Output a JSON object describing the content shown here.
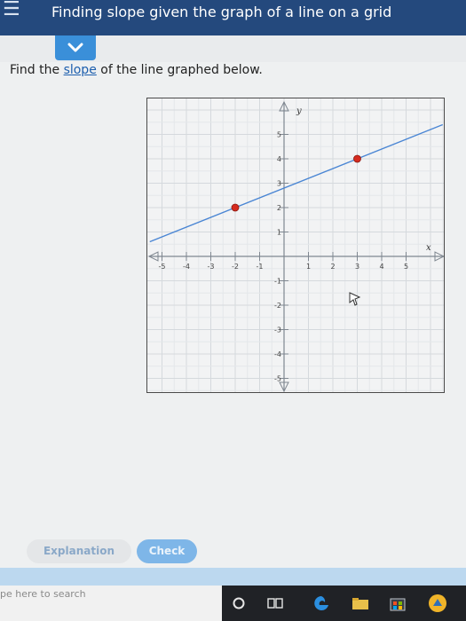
{
  "header": {
    "title": "Finding slope given the graph of a line on a grid"
  },
  "question": {
    "prefix": "Find the ",
    "link": "slope",
    "suffix": " of the line graphed below."
  },
  "graph": {
    "x_label": "x",
    "y_label": "y",
    "x_ticks": [
      "-5",
      "-4",
      "-3",
      "-2",
      "-1",
      "1",
      "2",
      "3",
      "4",
      "5"
    ],
    "y_ticks": [
      "5",
      "4",
      "3",
      "2",
      "1",
      "-1",
      "-2",
      "-3",
      "-4",
      "-5"
    ],
    "points": [
      {
        "x": -2,
        "y": 2
      },
      {
        "x": 3,
        "y": 4
      }
    ],
    "line_color": "#4a86d4",
    "point_color": "#d62b1f"
  },
  "buttons": {
    "explanation": "Explanation",
    "check": "Check"
  },
  "taskbar": {
    "search_placeholder": "pe here to search"
  },
  "colors": {
    "header": "#24497d",
    "accent": "#3a8fd9"
  }
}
